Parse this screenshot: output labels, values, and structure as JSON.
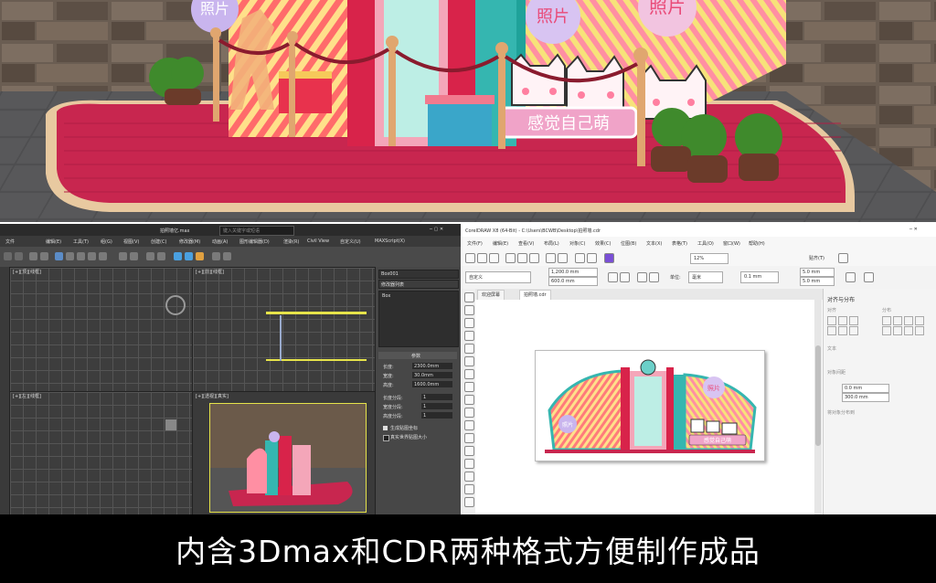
{
  "render": {
    "board_photo_text_1": "照片",
    "board_photo_text_2": "照片",
    "board_photo_text_3": "照片",
    "slogan_text": "感觉自己萌"
  },
  "max": {
    "window_title": "拍照墙亿.max",
    "search_placeholder": "键入关键字或短语",
    "menu_items": [
      "文件",
      "编辑(E)",
      "工具(T)",
      "组(G)",
      "视图(V)",
      "创建(C)",
      "修改器(M)",
      "动画(A)",
      "图形编辑器(D)",
      "渲染(R)",
      "Civil View",
      "自定义(U)",
      "MAXScript(X)"
    ],
    "viewport_top_left": "[+][顶][线框]",
    "viewport_top_right": "[+][前][线框]",
    "viewport_bottom_left": "[+][左][线框]",
    "viewport_bottom_right": "[+][透视][真实]",
    "panel_object_name": "Box001",
    "panel_modifier_list": "修改器列表",
    "panel_stack_item": "Box",
    "panel_params_title": "参数",
    "param_length_label": "长度:",
    "param_width_label": "宽度:",
    "param_height_label": "高度:",
    "param_length_value": "2300.0mm",
    "param_width_value": "30.0mm",
    "param_height_value": "1600.0mm",
    "param_segs_l": "长度分段:",
    "param_segs_w": "宽度分段:",
    "param_segs_h": "高度分段:",
    "param_seg_value": "1",
    "check_mapping": "生成贴图坐标",
    "check_realworld": "真实世界贴图大小"
  },
  "cdr": {
    "window_title": "CorelDRAW X8 (64-Bit) - C:\\Users\\BCWB\\Desktop\\拍照墙.cdr",
    "menu_items": [
      "文件(F)",
      "编辑(E)",
      "查看(V)",
      "布局(L)",
      "对象(C)",
      "效果(C)",
      "位图(B)",
      "文本(X)",
      "表格(T)",
      "工具(O)",
      "窗口(W)",
      "帮助(H)"
    ],
    "zoom_value": "12%",
    "snap_label": "贴齐(T)",
    "preset_label": "自定义",
    "page_width": "1,200.0 mm",
    "page_height": "600.0 mm",
    "units_label": "单位:",
    "units_value": "毫米",
    "nudge_value": "0.1 mm",
    "dup_x": "5.0 mm",
    "dup_y": "5.0 mm",
    "tab_welcome": "欢迎屏幕",
    "tab_doc": "拍照墙.cdr",
    "docker_title": "对齐与分布",
    "docker_align": "对齐",
    "docker_distribute": "分布",
    "docker_text": "文本",
    "docker_obj_distance": "对象间距",
    "docker_x_value": "0.0 mm",
    "docker_y_value": "300.0 mm",
    "docker_align_to": "将对象分布到",
    "art_photo_1": "照片",
    "art_photo_2": "照片",
    "art_slogan": "感觉自己萌"
  },
  "caption": "内含3Dmax和CDR两种格式方便制作成品"
}
